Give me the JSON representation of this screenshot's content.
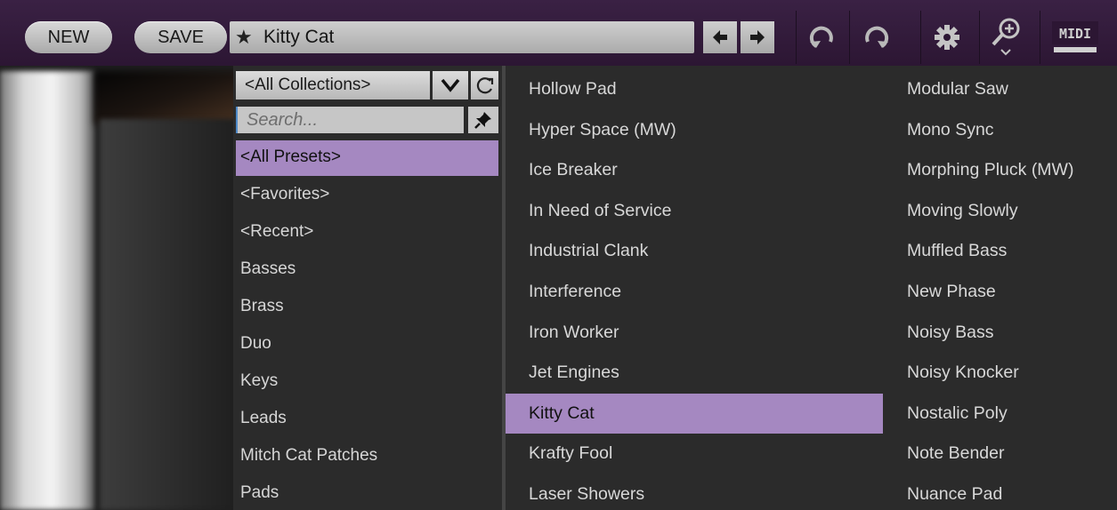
{
  "toolbar": {
    "new_label": "NEW",
    "save_label": "SAVE",
    "current_preset": "Kitty Cat",
    "favorite_icon": "star-icon",
    "prev_icon": "arrow-left-icon",
    "next_icon": "arrow-right-icon",
    "undo_icon": "undo-icon",
    "redo_icon": "redo-icon",
    "settings_icon": "gear-icon",
    "zoom_icon": "zoom-in-icon",
    "midi_label": "MIDI"
  },
  "browser": {
    "collection": "<All Collections>",
    "search_placeholder": "Search...",
    "categories": [
      {
        "label": "<All Presets>",
        "selected": true
      },
      {
        "label": "<Favorites>",
        "selected": false
      },
      {
        "label": "<Recent>",
        "selected": false
      },
      {
        "label": "Basses",
        "selected": false
      },
      {
        "label": "Brass",
        "selected": false
      },
      {
        "label": "Duo",
        "selected": false
      },
      {
        "label": "Keys",
        "selected": false
      },
      {
        "label": "Leads",
        "selected": false
      },
      {
        "label": "Mitch Cat Patches",
        "selected": false
      },
      {
        "label": "Pads",
        "selected": false
      }
    ],
    "presets_col1": [
      {
        "label": "Hollow Pad",
        "selected": false
      },
      {
        "label": "Hyper Space (MW)",
        "selected": false
      },
      {
        "label": "Ice Breaker",
        "selected": false
      },
      {
        "label": "In Need of Service",
        "selected": false
      },
      {
        "label": "Industrial Clank",
        "selected": false
      },
      {
        "label": "Interference",
        "selected": false
      },
      {
        "label": "Iron Worker",
        "selected": false
      },
      {
        "label": "Jet Engines",
        "selected": false
      },
      {
        "label": "Kitty Cat",
        "selected": true
      },
      {
        "label": "Krafty Fool",
        "selected": false
      },
      {
        "label": "Laser Showers",
        "selected": false
      }
    ],
    "presets_col2": [
      {
        "label": "Modular Saw",
        "selected": false
      },
      {
        "label": "Mono Sync",
        "selected": false
      },
      {
        "label": "Morphing Pluck (MW)",
        "selected": false
      },
      {
        "label": "Moving Slowly",
        "selected": false
      },
      {
        "label": "Muffled Bass",
        "selected": false
      },
      {
        "label": "New Phase",
        "selected": false
      },
      {
        "label": "Noisy Bass",
        "selected": false
      },
      {
        "label": "Noisy Knocker",
        "selected": false
      },
      {
        "label": "Nostalic Poly",
        "selected": false
      },
      {
        "label": "Note Bender",
        "selected": false
      },
      {
        "label": "Nuance Pad",
        "selected": false
      }
    ]
  },
  "colors": {
    "toolbar_bg": "#2c1633",
    "selection": "#a588c1",
    "list_bg": "#2b2b2b",
    "list_text": "#d8d8d8"
  }
}
